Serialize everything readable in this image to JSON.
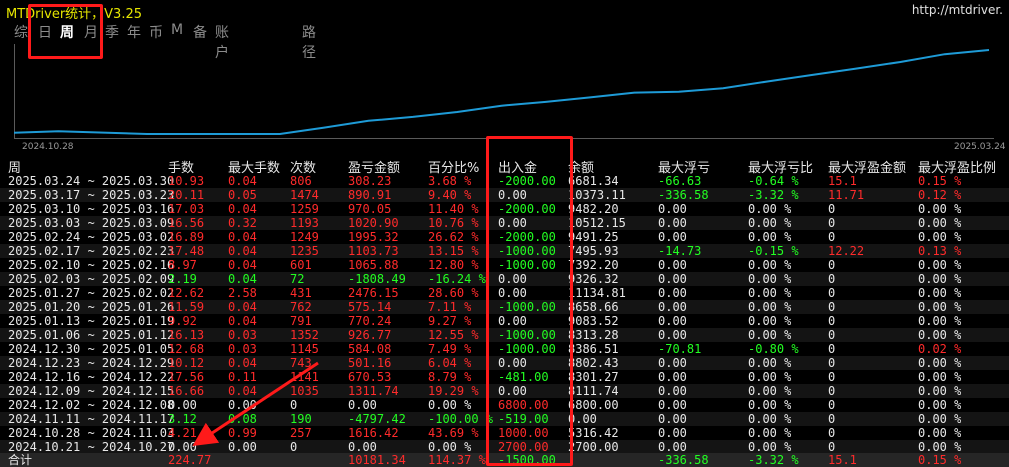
{
  "title": "MTDriver统计，V3.25",
  "url": "http://mtdriver.",
  "tabs": [
    "综",
    "日",
    "周",
    "月",
    "季",
    "年",
    "币",
    "M",
    "备",
    "账户",
    "路径"
  ],
  "active_tab": "周",
  "chart": {
    "start_label": "2024.10.28",
    "end_label": "2025.03.24",
    "line_color": "#1e9bd7",
    "points": [
      {
        "x": "2024.10.21",
        "y": 0.0
      },
      {
        "x": "2024.10.28",
        "y": 4.21
      },
      {
        "x": "2024.11.11",
        "y": -3.12
      },
      {
        "x": "2024.12.02",
        "y": -3.12
      },
      {
        "x": "2024.12.09",
        "y": 13.54
      },
      {
        "x": "2024.12.16",
        "y": 31.1
      },
      {
        "x": "2024.12.23",
        "y": 41.22
      },
      {
        "x": "2024.12.30",
        "y": 53.9
      },
      {
        "x": "2025.01.06",
        "y": 70.03
      },
      {
        "x": "2025.01.13",
        "y": 79.95
      },
      {
        "x": "2025.01.20",
        "y": 91.54
      },
      {
        "x": "2025.01.27",
        "y": 104.16
      },
      {
        "x": "2025.02.03",
        "y": 106.35
      },
      {
        "x": "2025.02.10",
        "y": 115.32
      },
      {
        "x": "2025.02.17",
        "y": 132.8
      },
      {
        "x": "2025.02.24",
        "y": 149.69
      },
      {
        "x": "2025.03.03",
        "y": 166.25
      },
      {
        "x": "2025.03.10",
        "y": 183.28
      },
      {
        "x": "2025.03.17",
        "y": 203.39
      },
      {
        "x": "2025.03.24",
        "y": 214.32
      }
    ]
  },
  "columns": [
    "周",
    "手数",
    "最大手数",
    "次数",
    "盈亏金额",
    "百分比%",
    "出入金",
    "余额",
    "最大浮亏",
    "最大浮亏比",
    "最大浮盈金额",
    "最大浮盈比例"
  ],
  "rows": [
    {
      "period": "2025.03.24 ~ 2025.03.30",
      "lots": "10.93",
      "maxlots": "0.04",
      "count": "806",
      "pnl": "308.23",
      "pct": "3.68 %",
      "flow": "-2000.00",
      "balance": "6681.34",
      "maxdd": "-66.63",
      "maxddpct": "-0.64 %",
      "maxfp": "15.1",
      "maxfppct": "0.15 %",
      "c": {
        "lots": "red",
        "maxlots": "red",
        "count": "red",
        "pnl": "red",
        "pct": "red",
        "flow": "grn",
        "balance": "wht",
        "maxdd": "grn",
        "maxddpct": "grn",
        "maxfp": "red",
        "maxfppct": "red"
      }
    },
    {
      "period": "2025.03.17 ~ 2025.03.23",
      "lots": "20.11",
      "maxlots": "0.05",
      "count": "1474",
      "pnl": "890.91",
      "pct": "9.40 %",
      "flow": "0.00",
      "balance": "10373.11",
      "maxdd": "-336.58",
      "maxddpct": "-3.32 %",
      "maxfp": "11.71",
      "maxfppct": "0.12 %",
      "c": {
        "lots": "red",
        "maxlots": "red",
        "count": "red",
        "pnl": "red",
        "pct": "red",
        "flow": "wht",
        "balance": "wht",
        "maxdd": "grn",
        "maxddpct": "grn",
        "maxfp": "red",
        "maxfppct": "red"
      }
    },
    {
      "period": "2025.03.10 ~ 2025.03.16",
      "lots": "17.03",
      "maxlots": "0.04",
      "count": "1259",
      "pnl": "970.05",
      "pct": "11.40 %",
      "flow": "-2000.00",
      "balance": "9482.20",
      "maxdd": "0.00",
      "maxddpct": "0.00 %",
      "maxfp": "0",
      "maxfppct": "0.00 %",
      "c": {
        "lots": "red",
        "maxlots": "red",
        "count": "red",
        "pnl": "red",
        "pct": "red",
        "flow": "grn",
        "balance": "wht",
        "maxdd": "wht",
        "maxddpct": "wht",
        "maxfp": "wht",
        "maxfppct": "wht"
      }
    },
    {
      "period": "2025.03.03 ~ 2025.03.09",
      "lots": "16.56",
      "maxlots": "0.32",
      "count": "1193",
      "pnl": "1020.90",
      "pct": "10.76 %",
      "flow": "0.00",
      "balance": "10512.15",
      "maxdd": "0.00",
      "maxddpct": "0.00 %",
      "maxfp": "0",
      "maxfppct": "0.00 %",
      "c": {
        "lots": "red",
        "maxlots": "red",
        "count": "red",
        "pnl": "red",
        "pct": "red",
        "flow": "wht",
        "balance": "wht",
        "maxdd": "wht",
        "maxddpct": "wht",
        "maxfp": "wht",
        "maxfppct": "wht"
      }
    },
    {
      "period": "2025.02.24 ~ 2025.03.02",
      "lots": "16.89",
      "maxlots": "0.04",
      "count": "1249",
      "pnl": "1995.32",
      "pct": "26.62 %",
      "flow": "-2000.00",
      "balance": "9491.25",
      "maxdd": "0.00",
      "maxddpct": "0.00 %",
      "maxfp": "0",
      "maxfppct": "0.00 %",
      "c": {
        "lots": "red",
        "maxlots": "red",
        "count": "red",
        "pnl": "red",
        "pct": "red",
        "flow": "grn",
        "balance": "wht",
        "maxdd": "wht",
        "maxddpct": "wht",
        "maxfp": "wht",
        "maxfppct": "wht"
      }
    },
    {
      "period": "2025.02.17 ~ 2025.02.23",
      "lots": "17.48",
      "maxlots": "0.04",
      "count": "1235",
      "pnl": "1103.73",
      "pct": "13.15 %",
      "flow": "-1000.00",
      "balance": "7495.93",
      "maxdd": "-14.73",
      "maxddpct": "-0.15 %",
      "maxfp": "12.22",
      "maxfppct": "0.13 %",
      "c": {
        "lots": "red",
        "maxlots": "red",
        "count": "red",
        "pnl": "red",
        "pct": "red",
        "flow": "grn",
        "balance": "wht",
        "maxdd": "grn",
        "maxddpct": "grn",
        "maxfp": "red",
        "maxfppct": "red"
      }
    },
    {
      "period": "2025.02.10 ~ 2025.02.16",
      "lots": "8.97",
      "maxlots": "0.04",
      "count": "601",
      "pnl": "1065.88",
      "pct": "12.80 %",
      "flow": "-1000.00",
      "balance": "7392.20",
      "maxdd": "0.00",
      "maxddpct": "0.00 %",
      "maxfp": "0",
      "maxfppct": "0.00 %",
      "c": {
        "lots": "red",
        "maxlots": "red",
        "count": "red",
        "pnl": "red",
        "pct": "red",
        "flow": "grn",
        "balance": "wht",
        "maxdd": "wht",
        "maxddpct": "wht",
        "maxfp": "wht",
        "maxfppct": "wht"
      }
    },
    {
      "period": "2025.02.03 ~ 2025.02.09",
      "lots": "2.19",
      "maxlots": "0.04",
      "count": "72",
      "pnl": "-1808.49",
      "pct": "-16.24 %",
      "flow": "0.00",
      "balance": "9326.32",
      "maxdd": "0.00",
      "maxddpct": "0.00 %",
      "maxfp": "0",
      "maxfppct": "0.00 %",
      "c": {
        "lots": "grn",
        "maxlots": "grn",
        "count": "grn",
        "pnl": "grn",
        "pct": "grn",
        "flow": "wht",
        "balance": "wht",
        "maxdd": "wht",
        "maxddpct": "wht",
        "maxfp": "wht",
        "maxfppct": "wht"
      }
    },
    {
      "period": "2025.01.27 ~ 2025.02.02",
      "lots": "12.62",
      "maxlots": "2.58",
      "count": "431",
      "pnl": "2476.15",
      "pct": "28.60 %",
      "flow": "0.00",
      "balance": "11134.81",
      "maxdd": "0.00",
      "maxddpct": "0.00 %",
      "maxfp": "0",
      "maxfppct": "0.00 %",
      "c": {
        "lots": "red",
        "maxlots": "red",
        "count": "red",
        "pnl": "red",
        "pct": "red",
        "flow": "wht",
        "balance": "wht",
        "maxdd": "wht",
        "maxddpct": "wht",
        "maxfp": "wht",
        "maxfppct": "wht"
      }
    },
    {
      "period": "2025.01.20 ~ 2025.01.26",
      "lots": "11.59",
      "maxlots": "0.04",
      "count": "762",
      "pnl": "575.14",
      "pct": "7.11 %",
      "flow": "-1000.00",
      "balance": "8658.66",
      "maxdd": "0.00",
      "maxddpct": "0.00 %",
      "maxfp": "0",
      "maxfppct": "0.00 %",
      "c": {
        "lots": "red",
        "maxlots": "red",
        "count": "red",
        "pnl": "red",
        "pct": "red",
        "flow": "grn",
        "balance": "wht",
        "maxdd": "wht",
        "maxddpct": "wht",
        "maxfp": "wht",
        "maxfppct": "wht"
      }
    },
    {
      "period": "2025.01.13 ~ 2025.01.19",
      "lots": "9.92",
      "maxlots": "0.04",
      "count": "791",
      "pnl": "770.24",
      "pct": "9.27 %",
      "flow": "0.00",
      "balance": "9083.52",
      "maxdd": "0.00",
      "maxddpct": "0.00 %",
      "maxfp": "0",
      "maxfppct": "0.00 %",
      "c": {
        "lots": "red",
        "maxlots": "red",
        "count": "red",
        "pnl": "red",
        "pct": "red",
        "flow": "wht",
        "balance": "wht",
        "maxdd": "wht",
        "maxddpct": "wht",
        "maxfp": "wht",
        "maxfppct": "wht"
      }
    },
    {
      "period": "2025.01.06 ~ 2025.01.12",
      "lots": "16.13",
      "maxlots": "0.03",
      "count": "1352",
      "pnl": "926.77",
      "pct": "12.55 %",
      "flow": "-1000.00",
      "balance": "8313.28",
      "maxdd": "0.00",
      "maxddpct": "0.00 %",
      "maxfp": "0",
      "maxfppct": "0.00 %",
      "c": {
        "lots": "red",
        "maxlots": "red",
        "count": "red",
        "pnl": "red",
        "pct": "red",
        "flow": "grn",
        "balance": "wht",
        "maxdd": "wht",
        "maxddpct": "wht",
        "maxfp": "wht",
        "maxfppct": "wht"
      }
    },
    {
      "period": "2024.12.30 ~ 2025.01.05",
      "lots": "12.68",
      "maxlots": "0.03",
      "count": "1145",
      "pnl": "584.08",
      "pct": "7.49 %",
      "flow": "-1000.00",
      "balance": "8386.51",
      "maxdd": "-70.81",
      "maxddpct": "-0.80 %",
      "maxfp": "0",
      "maxfppct": "0.02 %",
      "c": {
        "lots": "red",
        "maxlots": "red",
        "count": "red",
        "pnl": "red",
        "pct": "red",
        "flow": "grn",
        "balance": "wht",
        "maxdd": "grn",
        "maxddpct": "grn",
        "maxfp": "wht",
        "maxfppct": "red"
      }
    },
    {
      "period": "2024.12.23 ~ 2024.12.29",
      "lots": "10.12",
      "maxlots": "0.04",
      "count": "743",
      "pnl": "501.16",
      "pct": "6.04 %",
      "flow": "0.00",
      "balance": "8802.43",
      "maxdd": "0.00",
      "maxddpct": "0.00 %",
      "maxfp": "0",
      "maxfppct": "0.00 %",
      "c": {
        "lots": "red",
        "maxlots": "red",
        "count": "red",
        "pnl": "red",
        "pct": "red",
        "flow": "wht",
        "balance": "wht",
        "maxdd": "wht",
        "maxddpct": "wht",
        "maxfp": "wht",
        "maxfppct": "wht"
      }
    },
    {
      "period": "2024.12.16 ~ 2024.12.22",
      "lots": "17.56",
      "maxlots": "0.11",
      "count": "1141",
      "pnl": "670.53",
      "pct": "8.79 %",
      "flow": "-481.00",
      "balance": "8301.27",
      "maxdd": "0.00",
      "maxddpct": "0.00 %",
      "maxfp": "0",
      "maxfppct": "0.00 %",
      "c": {
        "lots": "red",
        "maxlots": "red",
        "count": "red",
        "pnl": "red",
        "pct": "red",
        "flow": "grn",
        "balance": "wht",
        "maxdd": "wht",
        "maxddpct": "wht",
        "maxfp": "wht",
        "maxfppct": "wht"
      }
    },
    {
      "period": "2024.12.09 ~ 2024.12.15",
      "lots": "16.66",
      "maxlots": "0.04",
      "count": "1035",
      "pnl": "1311.74",
      "pct": "19.29 %",
      "flow": "0.00",
      "balance": "8111.74",
      "maxdd": "0.00",
      "maxddpct": "0.00 %",
      "maxfp": "0",
      "maxfppct": "0.00 %",
      "c": {
        "lots": "red",
        "maxlots": "red",
        "count": "red",
        "pnl": "red",
        "pct": "red",
        "flow": "wht",
        "balance": "wht",
        "maxdd": "wht",
        "maxddpct": "wht",
        "maxfp": "wht",
        "maxfppct": "wht"
      }
    },
    {
      "period": "2024.12.02 ~ 2024.12.08",
      "lots": "0.00",
      "maxlots": "0.00",
      "count": "0",
      "pnl": "0.00",
      "pct": "0.00 %",
      "flow": "6800.00",
      "balance": "6800.00",
      "maxdd": "0.00",
      "maxddpct": "0.00 %",
      "maxfp": "0",
      "maxfppct": "0.00 %",
      "c": {
        "lots": "wht",
        "maxlots": "wht",
        "count": "wht",
        "pnl": "wht",
        "pct": "wht",
        "flow": "red",
        "balance": "wht",
        "maxdd": "wht",
        "maxddpct": "wht",
        "maxfp": "wht",
        "maxfppct": "wht"
      }
    },
    {
      "period": "2024.11.11 ~ 2024.11.17",
      "lots": "3.12",
      "maxlots": "0.08",
      "count": "190",
      "pnl": "-4797.42",
      "pct": "-100.00 %",
      "flow": "-519.00",
      "balance": "0.00",
      "maxdd": "0.00",
      "maxddpct": "0.00 %",
      "maxfp": "0",
      "maxfppct": "0.00 %",
      "c": {
        "lots": "grn",
        "maxlots": "grn",
        "count": "grn",
        "pnl": "grn",
        "pct": "grn",
        "flow": "grn",
        "balance": "wht",
        "maxdd": "wht",
        "maxddpct": "wht",
        "maxfp": "wht",
        "maxfppct": "wht"
      }
    },
    {
      "period": "2024.10.28 ~ 2024.11.03",
      "lots": "4.21",
      "maxlots": "0.99",
      "count": "257",
      "pnl": "1616.42",
      "pct": "43.69 %",
      "flow": "1000.00",
      "balance": "5316.42",
      "maxdd": "0.00",
      "maxddpct": "0.00 %",
      "maxfp": "0",
      "maxfppct": "0.00 %",
      "c": {
        "lots": "red",
        "maxlots": "red",
        "count": "red",
        "pnl": "red",
        "pct": "red",
        "flow": "red",
        "balance": "wht",
        "maxdd": "wht",
        "maxddpct": "wht",
        "maxfp": "wht",
        "maxfppct": "wht"
      }
    },
    {
      "period": "2024.10.21 ~ 2024.10.27",
      "lots": "0.00",
      "maxlots": "0.00",
      "count": "0",
      "pnl": "0.00",
      "pct": "0.00 %",
      "flow": "2700.00",
      "balance": "2700.00",
      "maxdd": "0.00",
      "maxddpct": "0.00 %",
      "maxfp": "0",
      "maxfppct": "0.00 %",
      "c": {
        "lots": "wht",
        "maxlots": "wht",
        "count": "wht",
        "pnl": "wht",
        "pct": "wht",
        "flow": "red",
        "balance": "wht",
        "maxdd": "wht",
        "maxddpct": "wht",
        "maxfp": "wht",
        "maxfppct": "wht"
      }
    }
  ],
  "total": {
    "label": "合计",
    "lots": "224.77",
    "pnl": "10181.34",
    "pct": "114.37 %",
    "flow": "-1500.00",
    "maxdd": "-336.58",
    "maxddpct": "-3.32 %",
    "maxfp": "15.1",
    "maxfppct": "0.15 %"
  },
  "colors": {
    "positive": "#ff2b2b",
    "negative": "#22ff22",
    "neutral": "#e8e8e8",
    "annotation": "#ff1a1a",
    "line": "#1e9bd7"
  }
}
